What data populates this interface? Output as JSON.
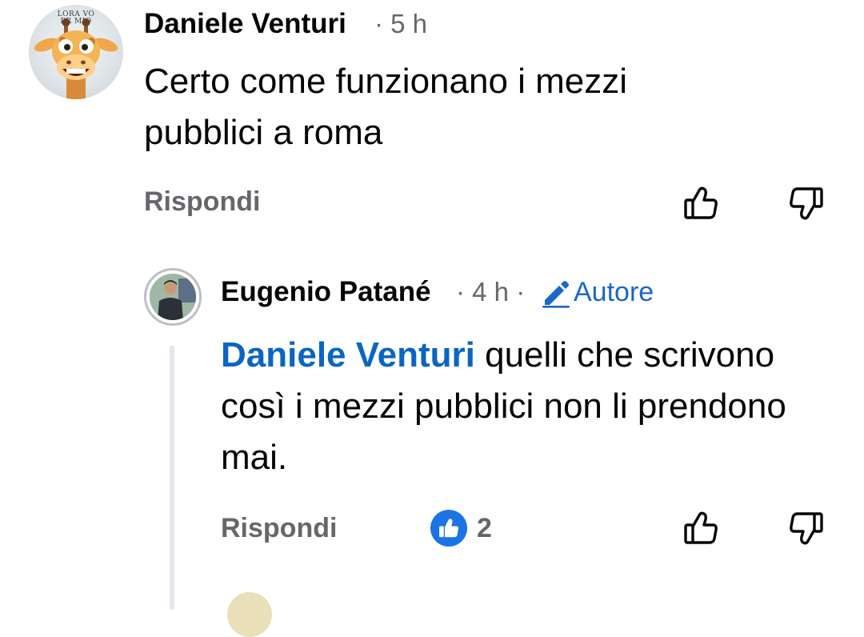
{
  "comments": [
    {
      "author": "Daniele Venturi",
      "time": "· 5 h",
      "avatar_caption": [
        "LORA VO",
        "ER MIO"
      ],
      "body": "Certo come funzionano i mezzi pubblici a roma",
      "reply_label": "Rispondi",
      "like_icon": "thumbs-up-outline-icon",
      "dislike_icon": "thumbs-down-outline-icon"
    }
  ],
  "reply": {
    "author": "Eugenio Patané",
    "time": "· 4 h ·",
    "badge_icon": "pencil-icon",
    "badge_label": "Autore",
    "mention": "Daniele Venturi",
    "body": " quelli che scrivono così i mezzi pubblici non li prendono mai.",
    "reply_label": "Rispondi",
    "reaction_icon": "like-reaction-icon",
    "reaction_count": "2"
  },
  "colors": {
    "secondary_text": "#65676b",
    "mention_blue": "#0a66c2",
    "like_blue": "#1b74e4",
    "thread_line": "#e4e6eb"
  }
}
